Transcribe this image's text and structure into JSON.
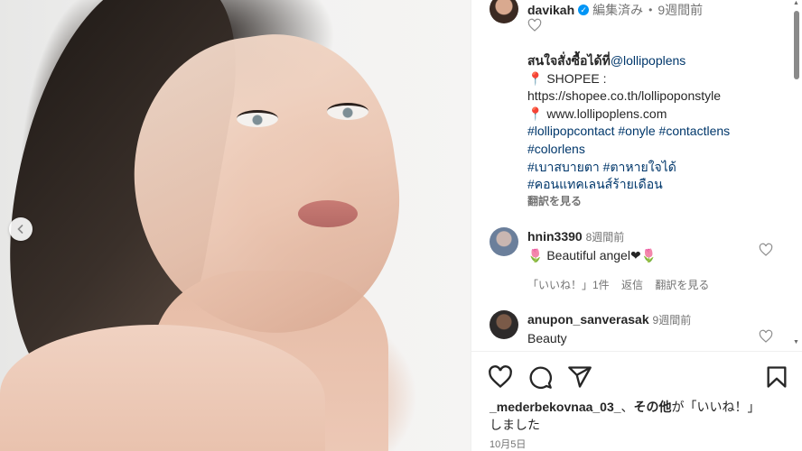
{
  "post": {
    "username": "davikah",
    "edited_label": "編集済み",
    "dot": "•",
    "time_ago": "9週間前",
    "caption_lines": [
      "สนใจสั่งซื้อได้ที่@lollipoplens",
      "📍 SHOPEE :",
      "https://shopee.co.th/lollipoponstyle",
      "📍 www.lollipoplens.com",
      "#lollipopcontact #onyle #contactlens",
      "#colorlens",
      "#เบาสบายตา #ตาหายใจได้",
      "#คอนแทคเลนส์ร้ายเดือน"
    ],
    "caption_lead": "สนใจสั่งซื้อได้ที่",
    "caption_mention": "@lollipoplens",
    "shopee_label": "📍 SHOPEE :",
    "shopee_url": "https://shopee.co.th/lollipoponstyle",
    "site": "📍 www.lollipoplens.com",
    "hashtags_1": "#lollipopcontact #onyle #contactlens",
    "hashtags_2": "#colorlens",
    "hashtags_3": "#เบาสบายตา #ตาหายใจได้",
    "hashtags_4": "#คอนแทคเลนส์ร้ายเดือน",
    "see_translation": "翻訳を見る"
  },
  "comments": [
    {
      "username": "hnin3390",
      "time_ago": "8週間前",
      "text": "🌷 Beautiful angel❤🌷",
      "likes": "「いいね！」1件",
      "reply": "返信",
      "translate": "翻訳を見る"
    },
    {
      "username": "anupon_sanverasak",
      "time_ago": "9週間前",
      "text": "Beauty"
    }
  ],
  "footer": {
    "liker": "_mederbekovnaa_03_",
    "separator": "、",
    "others": "その他",
    "liked_text_1": "が「いいね！」",
    "liked_text_2": "しました",
    "date": "10月5日"
  },
  "icons": {
    "prev": "chevron-left-icon",
    "like": "heart-icon",
    "comment": "comment-icon",
    "share": "share-icon",
    "save": "bookmark-icon",
    "verified": "verified-badge-icon"
  },
  "colors": {
    "link": "#00376b",
    "muted": "#737373",
    "verified": "#0095f6"
  }
}
